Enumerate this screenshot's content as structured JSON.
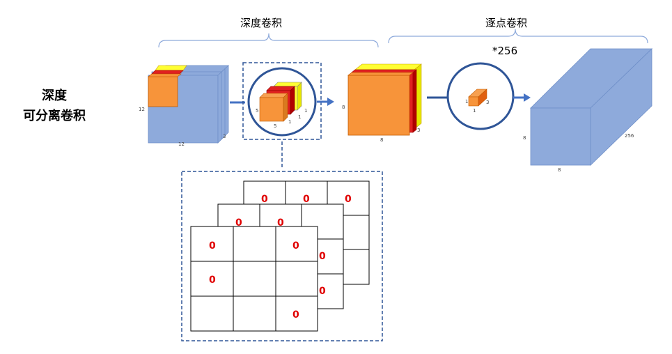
{
  "left_title": [
    "深度",
    "可分离卷积"
  ],
  "depthwise_label": "深度卷积",
  "pointwise_label": "逐点卷积",
  "multiplier": "*256",
  "input_dims": {
    "height": "12",
    "width": "12",
    "depth": "3"
  },
  "kernel_dims": {
    "h": "5",
    "w": "5",
    "d": "1"
  },
  "mid_dims": {
    "height": "8",
    "width": "8",
    "depth": "3"
  },
  "pw_kernel_dims": {
    "h": "1",
    "w": "1",
    "d": "3"
  },
  "output_dims": {
    "height": "8",
    "width": "8",
    "depth": "256"
  },
  "grid_zero": "0",
  "colors": {
    "blue": "#8eaadb",
    "orange": "#f7943a",
    "red": "#e02020",
    "yellow": "#ffff33",
    "frame": "#2f5597"
  }
}
